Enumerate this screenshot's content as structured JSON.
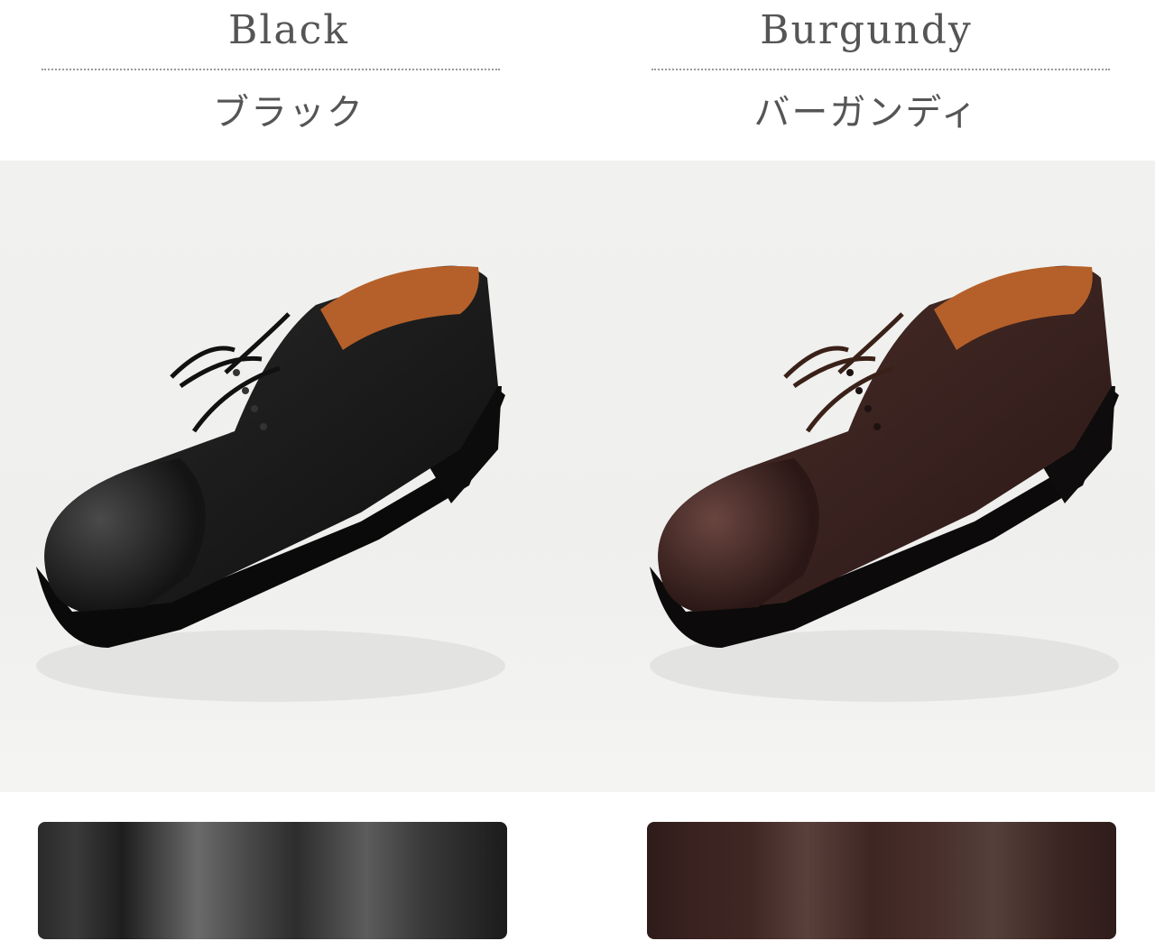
{
  "products": [
    {
      "name_en": "Black",
      "name_ja": "ブラック",
      "image_alt": "black-cap-toe-derby-shoe",
      "leather_color": "#141414",
      "swatch_color": "#3a3a3a"
    },
    {
      "name_en": "Burgundy",
      "name_ja": "バーガンディ",
      "image_alt": "burgundy-cap-toe-derby-shoe",
      "leather_color": "#3b2320",
      "swatch_color": "#4a302c"
    }
  ]
}
